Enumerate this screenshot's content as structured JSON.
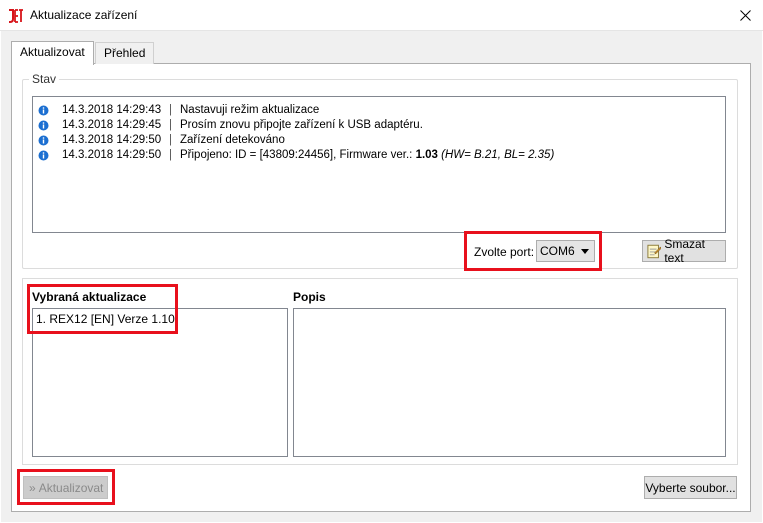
{
  "window": {
    "title": "Aktualizace zařízení",
    "logo_text": "JETI"
  },
  "tabs": [
    {
      "label": "Aktualizovat",
      "active": true
    },
    {
      "label": "Přehled",
      "active": false
    }
  ],
  "status": {
    "group_label": "Stav",
    "log": [
      {
        "timestamp": "14.3.2018 14:29:43",
        "sep": "|",
        "message": "Nastavuji režim aktualizace"
      },
      {
        "timestamp": "14.3.2018 14:29:45",
        "sep": "|",
        "message": "Prosím znovu připojte zařízení k USB adaptéru."
      },
      {
        "timestamp": "14.3.2018 14:29:50",
        "sep": "|",
        "message": "Zařízení detekováno"
      },
      {
        "timestamp": "14.3.2018 14:29:50",
        "sep": "|",
        "message_prefix": "Připojeno: ID = [43809:24456], Firmware ver.: ",
        "message_bold": "1.03",
        "message_italic": " (HW= B.21, BL= 2.35)"
      }
    ],
    "port_label": "Zvolte port:",
    "port_value": "COM6",
    "clear_label": "Smazat text"
  },
  "selection": {
    "title": "Vybraná aktualizace",
    "items": [
      "1. REX12 [EN] Verze  1.10"
    ],
    "description_title": "Popis"
  },
  "actions": {
    "update_label": "Aktualizovat",
    "update_prefix": "»",
    "browse_label": "Vyberte soubor..."
  },
  "colors": {
    "highlight": "#e8101c",
    "logo": "#d7141a",
    "info_icon": "#1c6fd1"
  }
}
